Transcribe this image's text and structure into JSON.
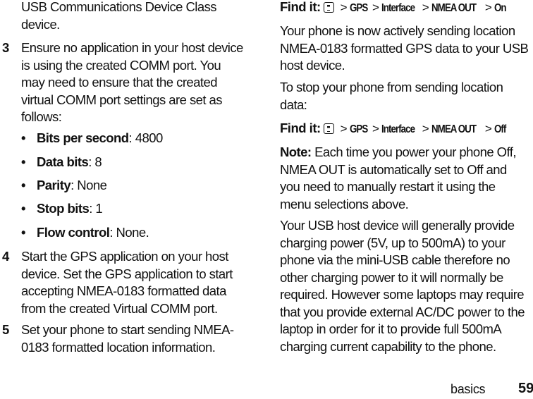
{
  "left_column": {
    "intro_lines": [
      "USB Communications Device Class",
      "device."
    ],
    "steps": [
      {
        "number": "3",
        "lines": [
          "Ensure no application in your host device",
          "is using the created COMM port.  You",
          "may need to ensure that the created",
          "virtual COMM port settings are set as",
          "follows:"
        ]
      },
      {
        "number": "4",
        "lines": [
          "Start the GPS application on your host",
          "device.  Set the GPS application to start",
          "accepting NMEA-0183 formatted data",
          "from the created Virtual COMM port."
        ]
      },
      {
        "number": "5",
        "lines": [
          "Set your phone to start sending NMEA-",
          "0183 formatted location information."
        ]
      }
    ],
    "bullet_char": "•",
    "settings": [
      {
        "name": "Bits per second",
        "value": ": 4800"
      },
      {
        "name": "Data bits",
        "value": ": 8"
      },
      {
        "name": "Parity",
        "value": ": None"
      },
      {
        "name": "Stop bits",
        "value": ": 1"
      },
      {
        "name": "Flow control",
        "value": ": None."
      }
    ]
  },
  "right_column": {
    "find_it_on": {
      "label": "Find it:",
      "icon": "menu-key-icon",
      "separator": ">",
      "path": [
        "GPS",
        "Interface",
        "NMEA OUT",
        "On"
      ]
    },
    "sending_lines": [
      "Your phone is now actively sending location",
      "NMEA-0183 formatted GPS data to your USB",
      "host device."
    ],
    "stop_lines": [
      "To stop your phone from sending location",
      "data:"
    ],
    "find_it_off": {
      "label": "Find it:",
      "icon": "menu-key-icon",
      "separator": ">",
      "path": [
        "GPS",
        "Interface",
        "NMEA OUT",
        "Off"
      ]
    },
    "note": {
      "label": "Note:",
      "lines": [
        " Each time you power your phone Off,",
        "NMEA OUT is automatically set to Off and",
        "you need to manually restart it using the",
        "menu selections above."
      ]
    },
    "charging_lines": [
      "Your USB host device will generally provide",
      "charging power (5V, up to 500mA) to your",
      "phone via the mini-USB cable therefore no",
      "other charging power to it will normally be",
      "required. However some laptops may require",
      "that you provide external AC/DC power to the",
      "laptop in order for it to provide full 500mA",
      "charging current capability to the phone."
    ]
  },
  "footer": {
    "section": "basics",
    "page_number": "59"
  }
}
